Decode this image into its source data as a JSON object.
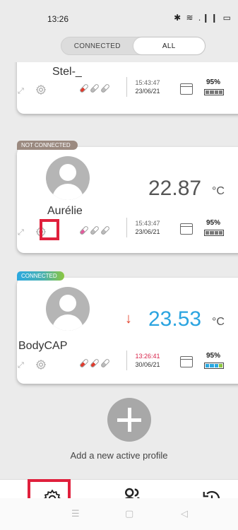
{
  "status": {
    "time": "13:26",
    "icons": "✱ ≋ .❙❙ ▭"
  },
  "segment": {
    "connected": "CONNECTED",
    "all": "ALL"
  },
  "cards": [
    {
      "name": "Stel-_",
      "time": "15:43:47",
      "date": "23/06/21",
      "battery": "95%"
    },
    {
      "status": "NOT CONNECTED",
      "name": "Aurélie",
      "temperature": "22.87",
      "unit": "°C",
      "time": "15:43:47",
      "date": "23/06/21",
      "battery": "95%"
    },
    {
      "status": "CONNECTED",
      "name": "BodyCAP",
      "temperature": "23.53",
      "unit": "°C",
      "trend": "↓",
      "time": "13:26:41",
      "date": "30/06/21",
      "battery": "95%"
    }
  ],
  "add": {
    "label": "Add a new active profile"
  },
  "icons": {
    "expand": "expand-icon",
    "gear": "gear-icon",
    "calendar": "calendar-icon",
    "users": "users-icon",
    "history": "history-icon"
  },
  "colors": {
    "accent_red": "#e0203c",
    "connected_blue": "#2ba4e0",
    "time_red": "#d8234a"
  }
}
